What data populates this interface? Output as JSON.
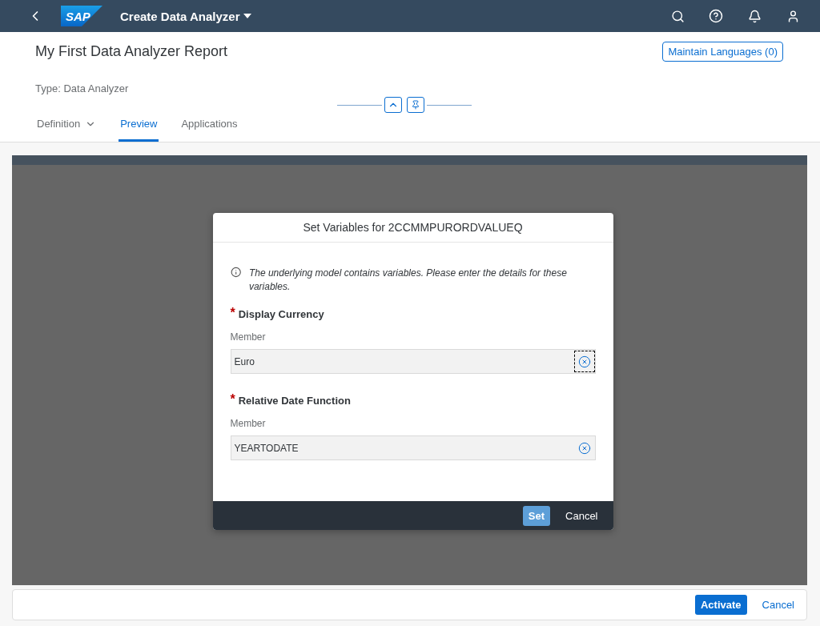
{
  "shell": {
    "logo": "SAP",
    "title": "Create Data Analyzer"
  },
  "header": {
    "title": "My First Data Analyzer Report",
    "languages_button": "Maintain Languages (0)",
    "type_label": "Type: Data Analyzer"
  },
  "tabs": [
    {
      "label": "Definition",
      "selected": false,
      "has_menu": true
    },
    {
      "label": "Preview",
      "selected": true,
      "has_menu": false
    },
    {
      "label": "Applications",
      "selected": false,
      "has_menu": false
    }
  ],
  "dialog": {
    "title": "Set Variables for 2CCMMPURORDVALUEQ",
    "info": "The underlying model contains variables. Please enter the details for these variables.",
    "variables": [
      {
        "label": "Display Currency",
        "required_mark": "*",
        "field_label": "Member",
        "value": "Euro",
        "focused": true
      },
      {
        "label": "Relative Date Function",
        "required_mark": "*",
        "field_label": "Member",
        "value": "YEARTODATE",
        "focused": false
      }
    ],
    "buttons": [
      {
        "label": "Set",
        "kind": "primary"
      },
      {
        "label": "Cancel",
        "kind": "plain"
      }
    ]
  },
  "footer": {
    "buttons": [
      {
        "label": "Activate",
        "kind": "primary"
      },
      {
        "label": "Cancel",
        "kind": "plain"
      }
    ]
  }
}
